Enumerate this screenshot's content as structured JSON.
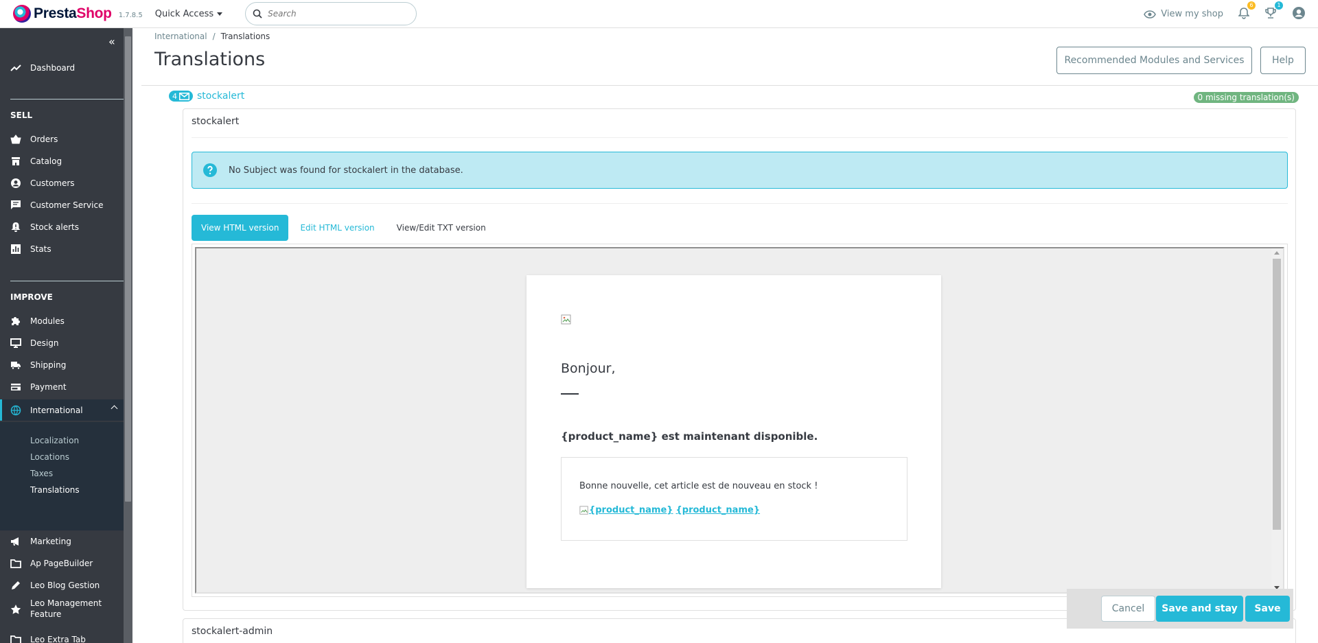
{
  "header": {
    "logo_main": "Presta",
    "logo_accent": "Shop",
    "version": "1.7.8.5",
    "quick_access": "Quick Access",
    "search_placeholder": "Search",
    "view_shop": "View my shop",
    "notif_orders_count": "6",
    "notif_customers_count": "1"
  },
  "sidebar": {
    "dashboard": "Dashboard",
    "sell_title": "SELL",
    "sell_items": [
      "Orders",
      "Catalog",
      "Customers",
      "Customer Service",
      "Stock alerts",
      "Stats"
    ],
    "improve_title": "IMPROVE",
    "improve_items": [
      "Modules",
      "Design",
      "Shipping",
      "Payment",
      "International"
    ],
    "international_sub": [
      "Localization",
      "Locations",
      "Taxes",
      "Translations"
    ],
    "extra_items": [
      "Marketing",
      "Ap PageBuilder",
      "Leo Blog Gestion",
      "Leo Management Feature",
      "Leo Extra Tab"
    ]
  },
  "page": {
    "breadcrumb_parent": "International",
    "breadcrumb_sep": "/",
    "breadcrumb_current": "Translations",
    "title": "Translations",
    "btn_recommended": "Recommended Modules and Services",
    "btn_help": "Help"
  },
  "mail": {
    "count": "4",
    "name": "stockalert",
    "missing": "0 missing translation(s)",
    "panel_title": "stockalert",
    "alert_text": "No Subject was found for stockalert in the database.",
    "tab_view_html": "View HTML version",
    "tab_edit_html": "Edit HTML version",
    "tab_txt": "View/Edit TXT version",
    "email_hello": "Bonjour,",
    "email_product": "{product_name} est maintenant disponible.",
    "email_news": "Bonne nouvelle, cet article est de nouveau en stock !",
    "email_link_1": "{product_name}",
    "email_link_2": "{product_name}",
    "next_panel_title": "stockalert-admin"
  },
  "footer": {
    "cancel": "Cancel",
    "save_stay": "Save and stay",
    "save": "Save"
  },
  "colors": {
    "brand": "#25b9d7",
    "sidebar_bg": "#363a41",
    "success": "#70b580"
  }
}
